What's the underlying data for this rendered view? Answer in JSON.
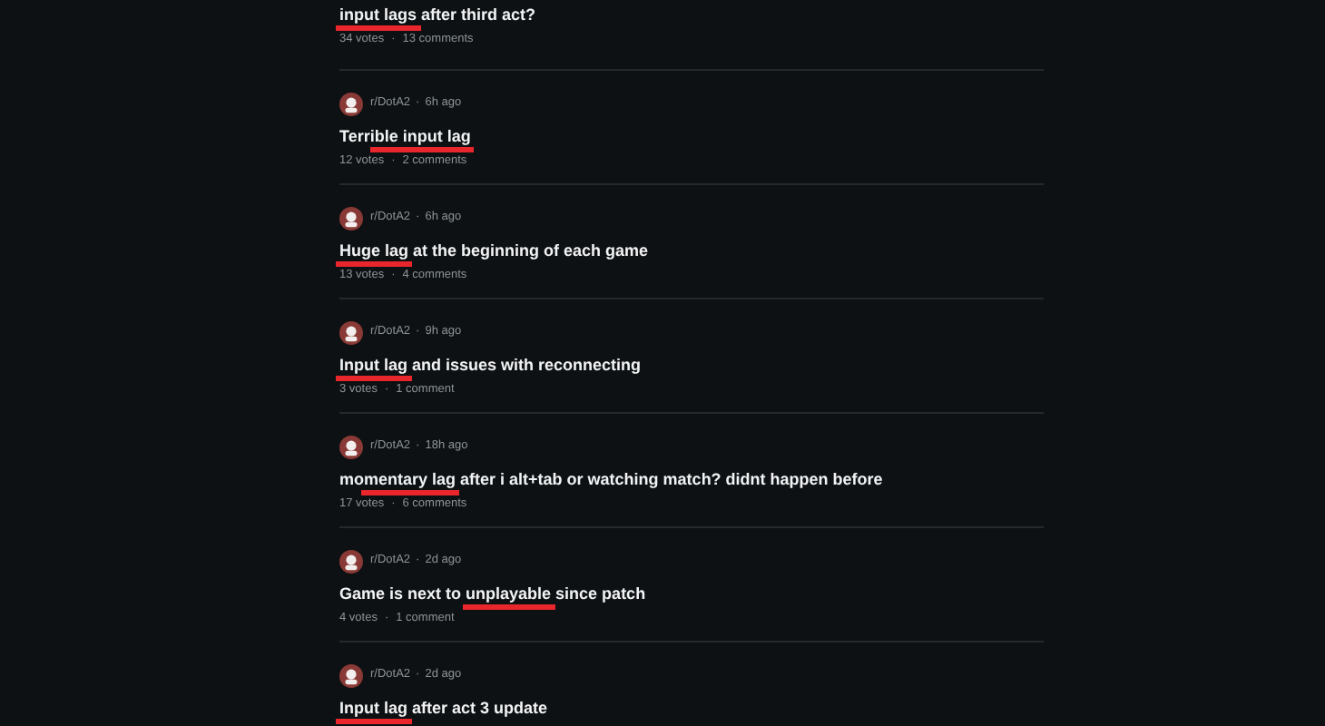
{
  "posts": [
    {
      "title_parts": [
        {
          "text": "input lags",
          "marked": true
        },
        {
          "text": " after third act?",
          "marked": false
        }
      ],
      "votes": "34 votes",
      "separator": "·",
      "comments": "13 comments"
    },
    {
      "community": "r/DotA2",
      "time": "6h ago",
      "title_parts": [
        {
          "text": "Terri",
          "marked": false
        },
        {
          "text": "ble input lag",
          "marked": true
        }
      ],
      "votes": "12 votes",
      "separator": "·",
      "comments": "2 comments"
    },
    {
      "community": "r/DotA2",
      "time": "6h ago",
      "title_parts": [
        {
          "text": "Huge lag",
          "marked": true
        },
        {
          "text": " at the beginning of each game",
          "marked": false
        }
      ],
      "votes": "13 votes",
      "separator": "·",
      "comments": "4 comments"
    },
    {
      "community": "r/DotA2",
      "time": "9h ago",
      "title_parts": [
        {
          "text": "Input lag",
          "marked": true
        },
        {
          "text": " and issues with reconnecting",
          "marked": false
        }
      ],
      "votes": "3 votes",
      "separator": "·",
      "comments": "1 comment"
    },
    {
      "community": "r/DotA2",
      "time": "18h ago",
      "title_parts": [
        {
          "text": "mo",
          "marked": false
        },
        {
          "text": "mentary lag",
          "marked": true
        },
        {
          "text": " after i alt+tab or watching match? didnt happen before",
          "marked": false
        }
      ],
      "votes": "17 votes",
      "separator": "·",
      "comments": "6 comments"
    },
    {
      "community": "r/DotA2",
      "time": "2d ago",
      "title_parts": [
        {
          "text": "Game is next to ",
          "marked": false
        },
        {
          "text": "unplayable",
          "marked": true
        },
        {
          "text": " since patch",
          "marked": false
        }
      ],
      "votes": "4 votes",
      "separator": "·",
      "comments": "1 comment"
    },
    {
      "community": "r/DotA2",
      "separator": "·",
      "time": "2d ago",
      "title_parts": [
        {
          "text": "Input lag",
          "marked": true
        },
        {
          "text": " after act 3 update",
          "marked": false
        }
      ]
    }
  ]
}
